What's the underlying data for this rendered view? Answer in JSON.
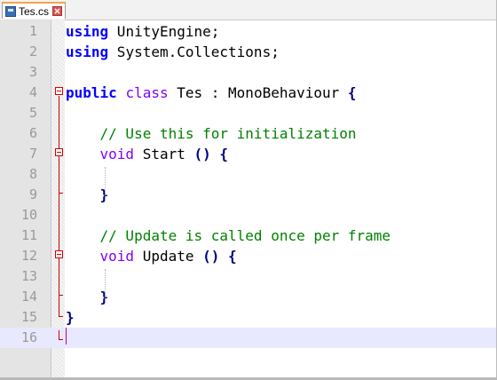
{
  "tab": {
    "filename": "Tes.cs",
    "file_icon": "save-file-icon",
    "close_icon": "close-icon"
  },
  "editor": {
    "current_line": 16,
    "lines": [
      {
        "number": "1",
        "tokens": [
          [
            "kw",
            "using"
          ],
          [
            "pl",
            " UnityEngine;"
          ]
        ]
      },
      {
        "number": "2",
        "tokens": [
          [
            "kw",
            "using"
          ],
          [
            "pl",
            " System.Collections;"
          ]
        ]
      },
      {
        "number": "3",
        "tokens": []
      },
      {
        "number": "4",
        "tokens": [
          [
            "kw",
            "public"
          ],
          [
            "pl",
            " "
          ],
          [
            "kw2",
            "class"
          ],
          [
            "pl",
            " Tes : MonoBehaviour "
          ],
          [
            "op",
            "{"
          ]
        ]
      },
      {
        "number": "5",
        "tokens": []
      },
      {
        "number": "6",
        "tokens": [
          [
            "pl",
            "    "
          ],
          [
            "cm",
            "// Use this for initialization"
          ]
        ]
      },
      {
        "number": "7",
        "tokens": [
          [
            "pl",
            "    "
          ],
          [
            "kw2",
            "void"
          ],
          [
            "pl",
            " Start "
          ],
          [
            "op",
            "()"
          ],
          [
            "pl",
            " "
          ],
          [
            "op",
            "{"
          ]
        ]
      },
      {
        "number": "8",
        "tokens": []
      },
      {
        "number": "9",
        "tokens": [
          [
            "pl",
            "    "
          ],
          [
            "op",
            "}"
          ]
        ]
      },
      {
        "number": "10",
        "tokens": []
      },
      {
        "number": "11",
        "tokens": [
          [
            "pl",
            "    "
          ],
          [
            "cm",
            "// Update is called once per frame"
          ]
        ]
      },
      {
        "number": "12",
        "tokens": [
          [
            "pl",
            "    "
          ],
          [
            "kw2",
            "void"
          ],
          [
            "pl",
            " Update "
          ],
          [
            "op",
            "()"
          ],
          [
            "pl",
            " "
          ],
          [
            "op",
            "{"
          ]
        ]
      },
      {
        "number": "13",
        "tokens": []
      },
      {
        "number": "14",
        "tokens": [
          [
            "pl",
            "    "
          ],
          [
            "op",
            "}"
          ]
        ]
      },
      {
        "number": "15",
        "tokens": [
          [
            "op",
            "}"
          ]
        ]
      },
      {
        "number": "16",
        "tokens": []
      }
    ]
  },
  "colors": {
    "keyword": "#0000ff",
    "type_keyword": "#8000ff",
    "comment": "#008000",
    "operator": "#000080",
    "fold_marker": "#d00000",
    "current_line": "#e8e8ff",
    "tab_accent": "#f6a24a"
  }
}
